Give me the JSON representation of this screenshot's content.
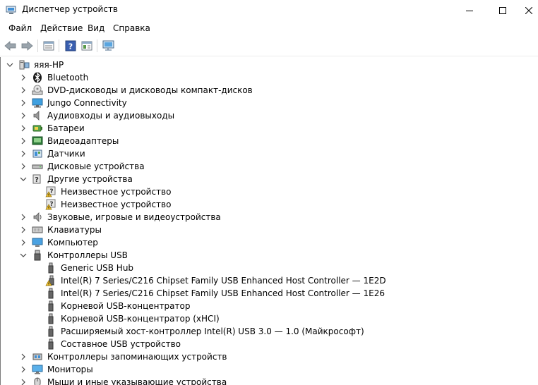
{
  "window": {
    "title": "Диспетчер устройств"
  },
  "menu": [
    "Файл",
    "Действие",
    "Вид",
    "Справка"
  ],
  "toolbar": {
    "buttons": [
      "back-icon",
      "forward-icon",
      "properties-icon",
      "help-icon",
      "details-icon",
      "monitor-scan-icon"
    ]
  },
  "tree": {
    "root": "яяя-HP",
    "items": [
      {
        "label": "Bluetooth",
        "level": 1,
        "state": "collapsed",
        "icon": "bluetooth-icon"
      },
      {
        "label": "DVD-дисководы и дисководы компакт-дисков",
        "level": 1,
        "state": "collapsed",
        "icon": "dvd-drive-icon"
      },
      {
        "label": "Jungo Connectivity",
        "level": 1,
        "state": "collapsed",
        "icon": "jungo-icon"
      },
      {
        "label": "Аудиовходы и аудиовыходы",
        "level": 1,
        "state": "collapsed",
        "icon": "speaker-icon"
      },
      {
        "label": "Батареи",
        "level": 1,
        "state": "collapsed",
        "icon": "battery-icon"
      },
      {
        "label": "Видеоадаптеры",
        "level": 1,
        "state": "collapsed",
        "icon": "display-adapter-icon"
      },
      {
        "label": "Датчики",
        "level": 1,
        "state": "collapsed",
        "icon": "sensor-icon"
      },
      {
        "label": "Дисковые устройства",
        "level": 1,
        "state": "collapsed",
        "icon": "disk-drive-icon"
      },
      {
        "label": "Другие устройства",
        "level": 1,
        "state": "expanded",
        "icon": "other-devices-icon"
      },
      {
        "label": "Неизвестное устройство",
        "level": 2,
        "state": "leaf",
        "icon": "unknown-device-warning-icon"
      },
      {
        "label": "Неизвестное устройство",
        "level": 2,
        "state": "leaf",
        "icon": "unknown-device-warning-icon"
      },
      {
        "label": "Звуковые, игровые и видеоустройства",
        "level": 1,
        "state": "collapsed",
        "icon": "sound-icon"
      },
      {
        "label": "Клавиатуры",
        "level": 1,
        "state": "collapsed",
        "icon": "keyboard-icon"
      },
      {
        "label": "Компьютер",
        "level": 1,
        "state": "collapsed",
        "icon": "computer-icon"
      },
      {
        "label": "Контроллеры USB",
        "level": 1,
        "state": "expanded",
        "icon": "usb-icon"
      },
      {
        "label": "Generic USB Hub",
        "level": 2,
        "state": "leaf",
        "icon": "usb-plug-icon"
      },
      {
        "label": "Intel(R) 7 Series/C216 Chipset Family USB Enhanced Host Controller — 1E2D",
        "level": 2,
        "state": "leaf",
        "icon": "usb-warning-icon"
      },
      {
        "label": "Intel(R) 7 Series/C216 Chipset Family USB Enhanced Host Controller — 1E26",
        "level": 2,
        "state": "leaf",
        "icon": "usb-plug-icon"
      },
      {
        "label": "Корневой USB-концентратор",
        "level": 2,
        "state": "leaf",
        "icon": "usb-plug-icon"
      },
      {
        "label": "Корневой USB-концентратор (xHCI)",
        "level": 2,
        "state": "leaf",
        "icon": "usb-plug-icon"
      },
      {
        "label": "Расширяемый хост-контроллер Intel(R) USB 3.0 — 1.0 (Майкрософт)",
        "level": 2,
        "state": "leaf",
        "icon": "usb-plug-icon"
      },
      {
        "label": "Составное USB устройство",
        "level": 2,
        "state": "leaf",
        "icon": "usb-plug-icon"
      },
      {
        "label": "Контроллеры запоминающих устройств",
        "level": 1,
        "state": "collapsed",
        "icon": "storage-controller-icon"
      },
      {
        "label": "Мониторы",
        "level": 1,
        "state": "collapsed",
        "icon": "monitor-icon"
      },
      {
        "label": "Мыши и иные указывающие устройства",
        "level": 1,
        "state": "collapsed",
        "icon": "mouse-icon"
      }
    ]
  }
}
